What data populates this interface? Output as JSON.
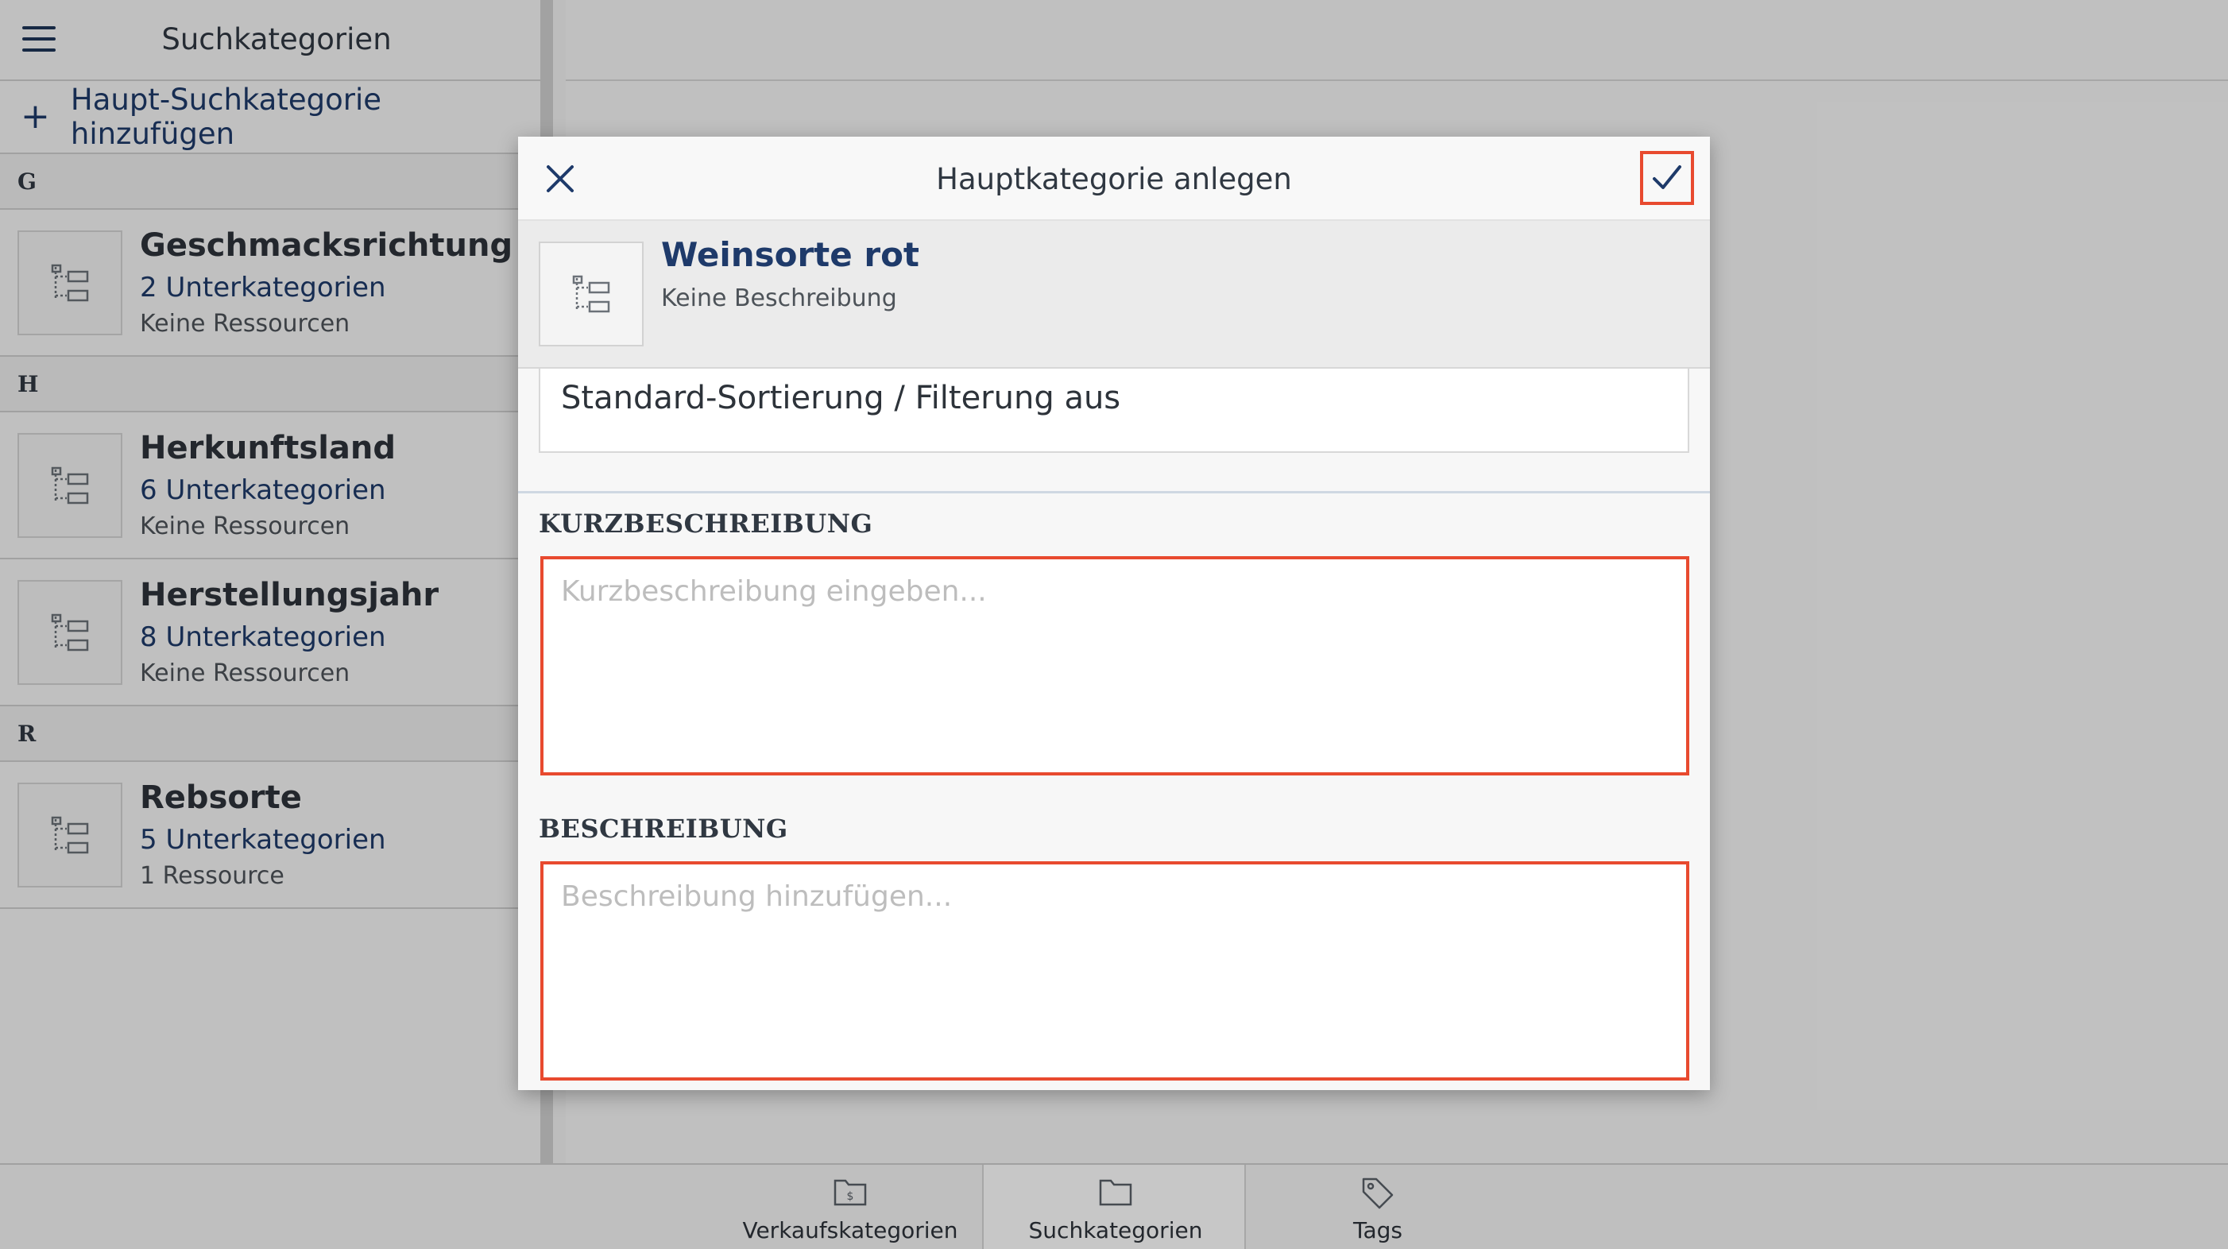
{
  "sidebar": {
    "title": "Suchkategorien",
    "add_label": "Haupt-Suchkategorie hinzufügen",
    "groups": [
      {
        "letter": "G",
        "items": [
          {
            "name": "Geschmacksrichtung",
            "subcategories": "2 Unterkategorien",
            "resources": "Keine Ressourcen"
          }
        ]
      },
      {
        "letter": "H",
        "items": [
          {
            "name": "Herkunftsland",
            "subcategories": "6 Unterkategorien",
            "resources": "Keine Ressourcen"
          },
          {
            "name": "Herstellungsjahr",
            "subcategories": "8 Unterkategorien",
            "resources": "Keine Ressourcen"
          }
        ]
      },
      {
        "letter": "R",
        "items": [
          {
            "name": "Rebsorte",
            "subcategories": "5 Unterkategorien",
            "resources": "1 Ressource"
          }
        ]
      }
    ]
  },
  "dialog": {
    "title": "Hauptkategorie anlegen",
    "category": {
      "name": "Weinsorte rot",
      "description": "Keine Beschreibung"
    },
    "sort_option": "Standard-Sortierung / Filterung aus",
    "short_description": {
      "label": "KURZBESCHREIBUNG",
      "placeholder": "Kurzbeschreibung eingeben..."
    },
    "description": {
      "label": "BESCHREIBUNG",
      "placeholder": "Beschreibung hinzufügen..."
    }
  },
  "bottom_tabs": [
    {
      "label": "Verkaufskategorien",
      "icon": "folder-dollar-icon"
    },
    {
      "label": "Suchkategorien",
      "icon": "folder-icon",
      "active": true
    },
    {
      "label": "Tags",
      "icon": "tag-icon"
    }
  ],
  "colors": {
    "accent_navy": "#1e3a6a",
    "highlight_red": "#e84a2f"
  }
}
